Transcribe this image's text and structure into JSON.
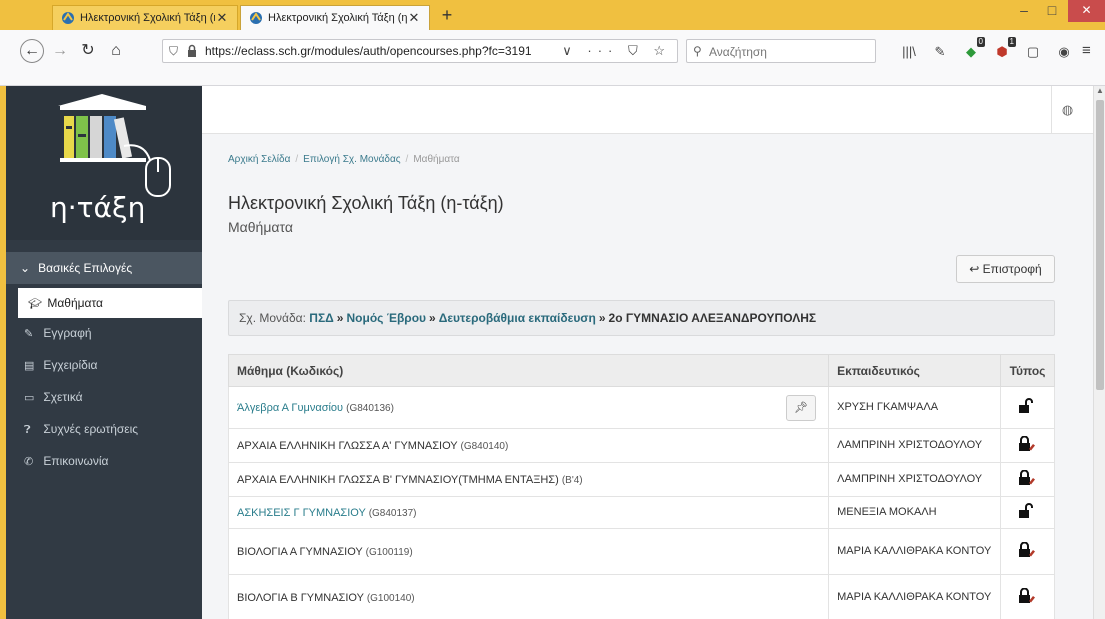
{
  "browser": {
    "tabs": [
      {
        "title": "Ηλεκτρονική Σχολική Τάξη (η-τ",
        "active": false
      },
      {
        "title": "Ηλεκτρονική Σχολική Τάξη (η-τ",
        "active": true
      }
    ],
    "new_tab": "+",
    "window": {
      "minimize": "–",
      "maximize": "□",
      "close": "✕"
    },
    "url": "https://eclass.sch.gr/modules/auth/opencourses.php?fc=3191",
    "url_actions": "∨ ··· ⛉ ☆",
    "search_placeholder": "Αναζήτηση",
    "badges": {
      "extension": "0",
      "adblock": "1"
    }
  },
  "site": {
    "logo_text": "η·τάξη",
    "sidebar": {
      "section_label": "Βασικές Επιλογές",
      "items": [
        {
          "label": "Μαθήματα",
          "icon": "graduation-cap-icon",
          "active": true
        },
        {
          "label": "Εγγραφή",
          "icon": "edit-icon",
          "active": false
        },
        {
          "label": "Εγχειρίδια",
          "icon": "file-icon",
          "active": false
        },
        {
          "label": "Σχετικά",
          "icon": "credit-card-icon",
          "active": false
        },
        {
          "label": "Συχνές ερωτήσεις",
          "icon": "question-circle-icon",
          "active": false
        },
        {
          "label": "Επικοινωνία",
          "icon": "phone-icon",
          "active": false
        }
      ]
    },
    "breadcrumb": [
      "Αρχική Σελίδα",
      "Επιλογή Σχ. Μονάδας",
      "Μαθήματα"
    ],
    "page_title": "Ηλεκτρονική Σχολική Τάξη (η-τάξη)",
    "page_subtitle": "Μαθήματα",
    "back_button": "Επιστροφή",
    "unit": {
      "prefix": "Σχ. Μονάδα:",
      "path": [
        "ΠΣΔ",
        "Νομός Έβρου",
        "Δευτεροβάθμια εκπαίδευση"
      ],
      "separator": "»",
      "final": "2ο ΓΥΜΝΑΣΙΟ ΑΛΕΞΑΝΔΡΟΥΠΟΛΗΣ"
    },
    "table": {
      "headers": [
        "Μάθημα (Κωδικός)",
        "Εκπαιδευτικός",
        "Τύπος"
      ],
      "rows": [
        {
          "title": "Άλγεβρα Α Γυμνασίου",
          "code": "(G840136)",
          "link": true,
          "teacher": "ΧΡΥΣΗ ΓΚΑΜΨΑΛΑ",
          "type": "open",
          "pinned": true
        },
        {
          "title": "ΑΡΧΑΙΑ ΕΛΛΗΝΙΚΗ ΓΛΩΣΣΑ Α' ΓΥΜΝΑΣΙΟΥ",
          "code": "(G840140)",
          "link": false,
          "teacher": "ΛΑΜΠΡΙΝΗ ΧΡΙΣΤΟΔΟΥΛΟΥ",
          "type": "registration",
          "pinned": false
        },
        {
          "title": "ΑΡΧΑΙΑ ΕΛΛΗΝΙΚΗ ΓΛΩΣΣΑ Β' ΓΥΜΝΑΣΙΟΥ(ΤΜΗΜΑ ΕΝΤΑΞΗΣ)",
          "code": "(Β'4)",
          "link": false,
          "teacher": "ΛΑΜΠΡΙΝΗ ΧΡΙΣΤΟΔΟΥΛΟΥ",
          "type": "registration",
          "pinned": false
        },
        {
          "title": "ΑΣΚΗΣΕΙΣ Γ ΓΥΜΝΑΣΙΟΥ",
          "code": "(G840137)",
          "link": true,
          "teacher": "ΜΕΝΕΞΙΑ ΜΟΚΑΛΗ",
          "type": "open",
          "pinned": false
        },
        {
          "title": "ΒΙΟΛΟΓΙΑ Α ΓΥΜΝΑΣΙΟΥ",
          "code": "(G100119)",
          "link": false,
          "teacher": "ΜΑΡΙΑ ΚΑΛΛΙΘΡΑΚΑ ΚΟΝΤΟΥ",
          "type": "registration",
          "pinned": false
        },
        {
          "title": "ΒΙΟΛΟΓΙΑ Β ΓΥΜΝΑΣΙΟΥ",
          "code": "(G100140)",
          "link": false,
          "teacher": "ΜΑΡΙΑ ΚΑΛΛΙΘΡΑΚΑ ΚΟΝΤΟΥ",
          "type": "registration",
          "pinned": false
        }
      ]
    }
  },
  "colors": {
    "sidebar_bg": "#313a44",
    "link": "#2a7d8c",
    "chrome_accent": "#f0c040"
  }
}
